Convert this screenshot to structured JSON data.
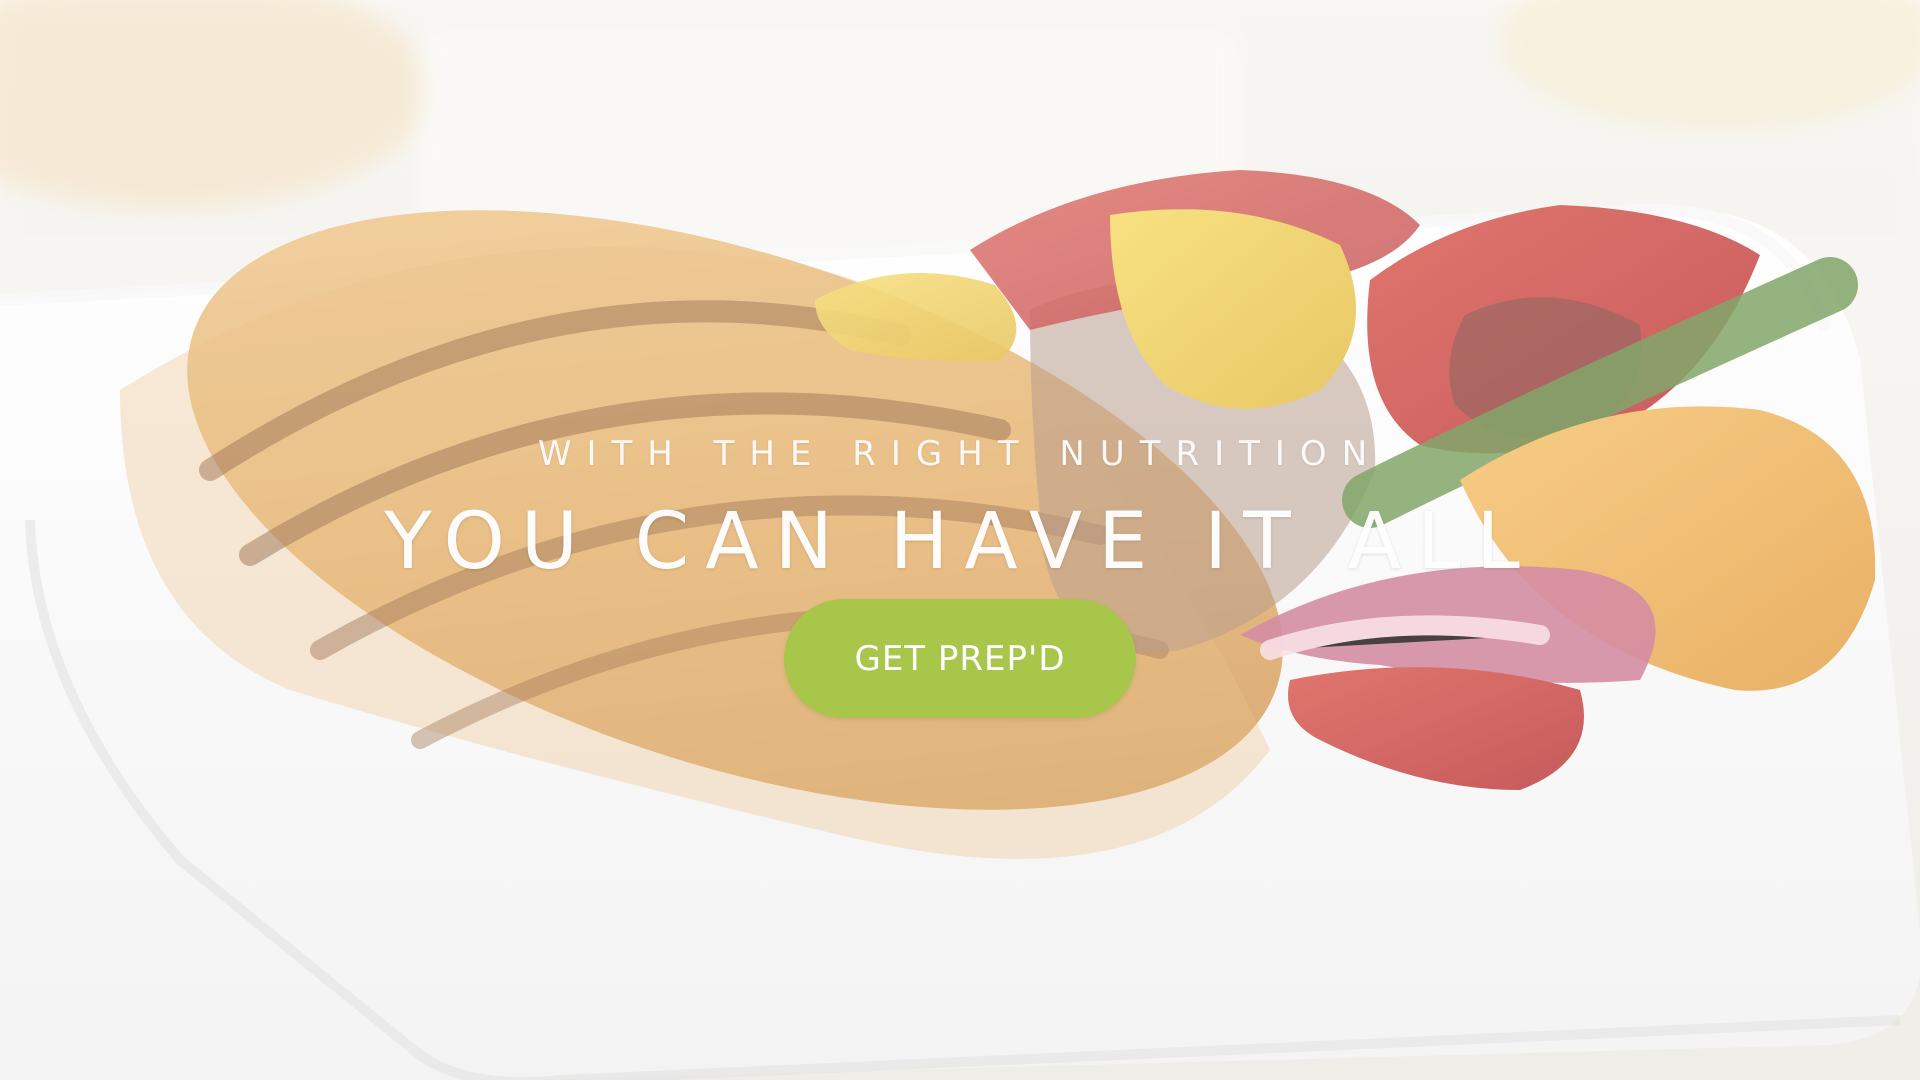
{
  "hero": {
    "kicker": "WITH THE RIGHT NUTRITION",
    "title": "YOU CAN HAVE IT ALL",
    "cta": "GET PREP'D"
  },
  "colors": {
    "cta_background": "#a8c74a",
    "text": "#ffffff"
  }
}
